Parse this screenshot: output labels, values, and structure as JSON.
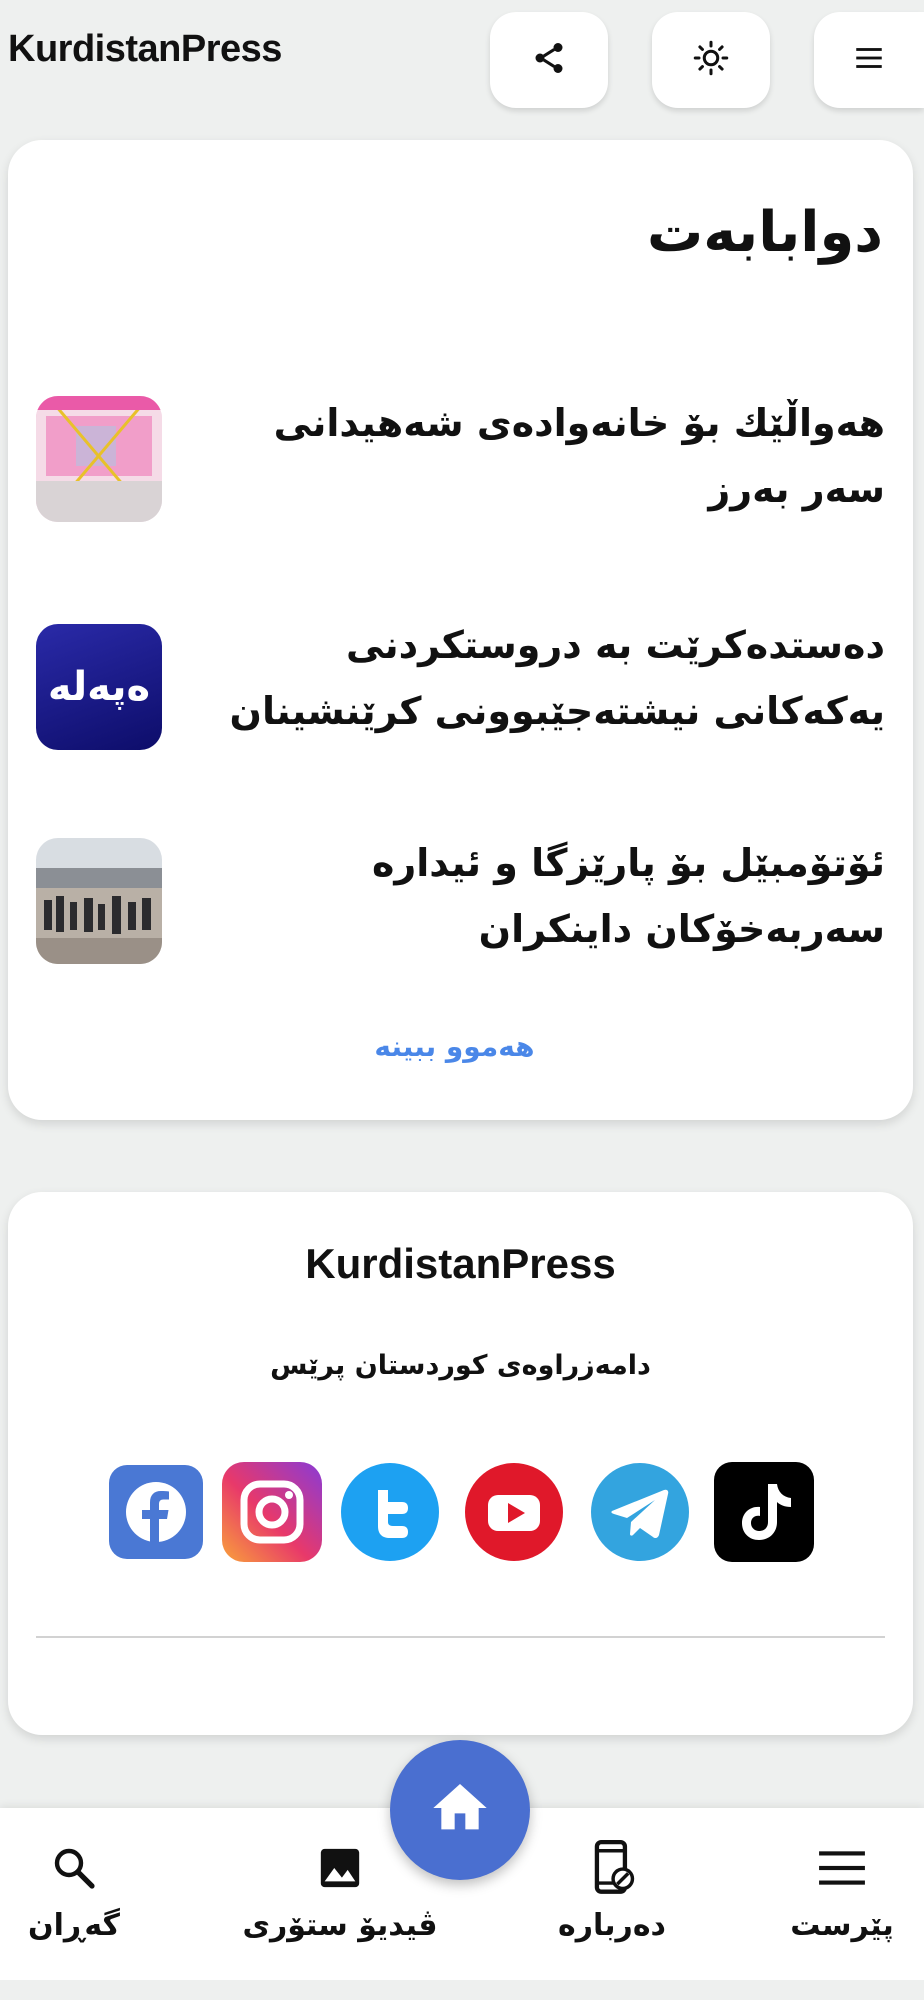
{
  "app": {
    "title": "KurdistanPress"
  },
  "header": {
    "share_icon": "share-icon",
    "theme_icon": "sun-icon",
    "menu_icon": "hamburger-menu-icon"
  },
  "latest": {
    "title": "دوابابەت",
    "items": [
      {
        "title": "هەواڵێك بۆ خانەوادەی شەهیدانی سەر بەرز",
        "thumb": "pink-decorated-room"
      },
      {
        "title": "دەستدەکرێت بە دروستکردنی یەکەکانی نیشتەجێبوونی کرێنشینان",
        "thumb": "logo",
        "logo_text": "ەپەلە"
      },
      {
        "title": "ئۆتۆمبێل بۆ پارێزگا و ئیدارە سەربەخۆکان داینکران",
        "thumb": "crowd-photo"
      }
    ],
    "see_all": "هەموو ببینە"
  },
  "footer": {
    "brand": "KurdistanPress",
    "description": "دامەزراوەی کوردستان پرێس",
    "socials": [
      "facebook",
      "instagram",
      "twitter",
      "youtube",
      "telegram",
      "tiktok"
    ]
  },
  "bottom_nav": {
    "items": [
      {
        "label": "گەڕان",
        "icon": "search-icon"
      },
      {
        "label": "ڤیدیۆ ستۆری",
        "icon": "image-icon"
      },
      {
        "label": "دەربارە",
        "icon": "phone-info-icon"
      },
      {
        "label": "پێرست",
        "icon": "menu-icon"
      }
    ],
    "home_icon": "home-icon"
  },
  "colors": {
    "background": "#eef0ef",
    "accent": "#4a87e8",
    "fab": "#4a6fd0"
  }
}
